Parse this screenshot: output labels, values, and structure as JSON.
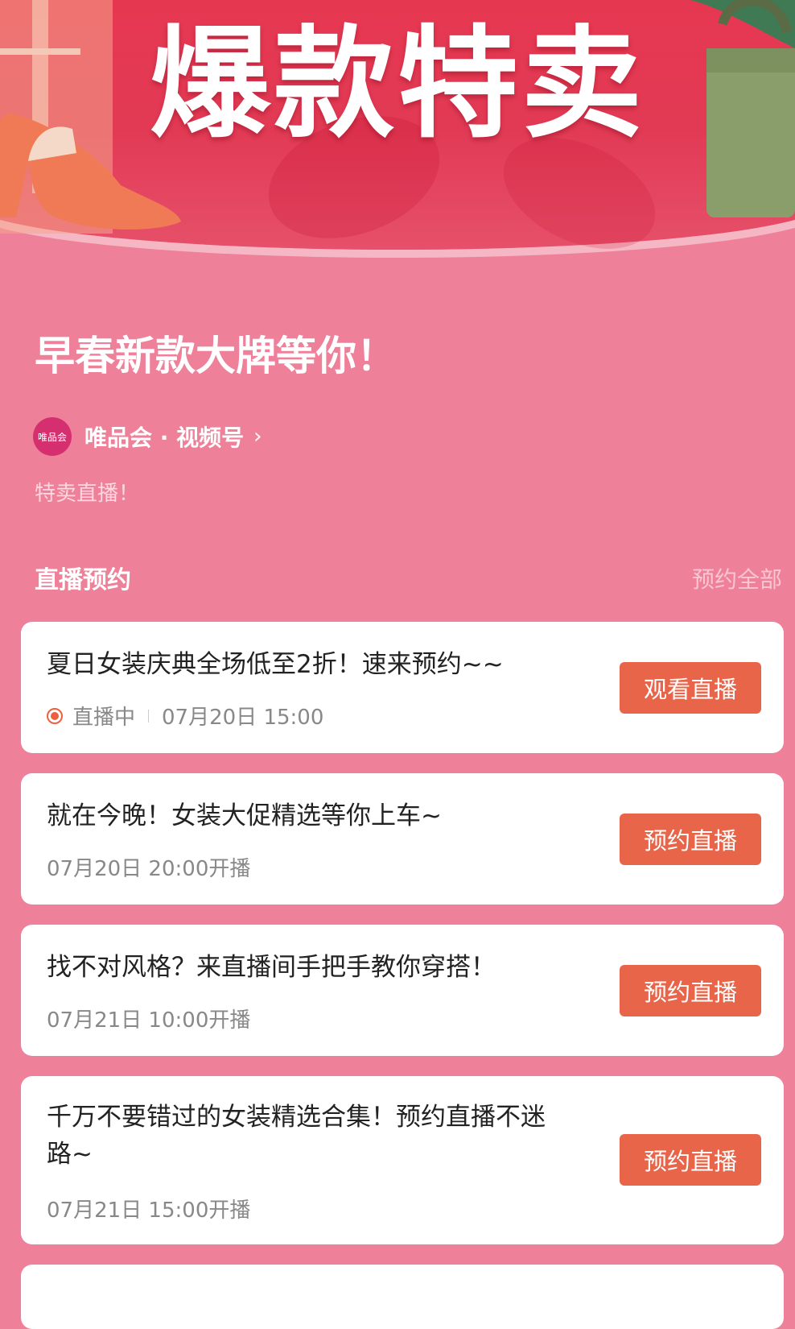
{
  "banner": {
    "title": "爆款特卖"
  },
  "headline": "早春新款大牌等你！",
  "account": {
    "avatar_text": "唯品会",
    "name": "唯品会 · 视频号",
    "chevron": "›"
  },
  "subtitle": "特卖直播！",
  "section": {
    "title": "直播预约",
    "action": "预约全部"
  },
  "cards": [
    {
      "title": "夏日女装庆典全场低至2折！速来预约~~",
      "status": "直播中",
      "time": "07月20日 15:00",
      "button": "观看直播"
    },
    {
      "title": "就在今晚！女装大促精选等你上车~",
      "time": "07月20日 20:00开播",
      "button": "预约直播"
    },
    {
      "title": "找不对风格？来直播间手把手教你穿搭！",
      "time": "07月21日 10:00开播",
      "button": "预约直播"
    },
    {
      "title": "千万不要错过的女装精选合集！预约直播不迷路~",
      "time": "07月21日 15:00开播",
      "button": "预约直播"
    }
  ],
  "colors": {
    "page_bg": "#ef8099",
    "banner_red": "#e8364f",
    "button_orange": "#e8654a",
    "live_red": "#ec6040"
  }
}
